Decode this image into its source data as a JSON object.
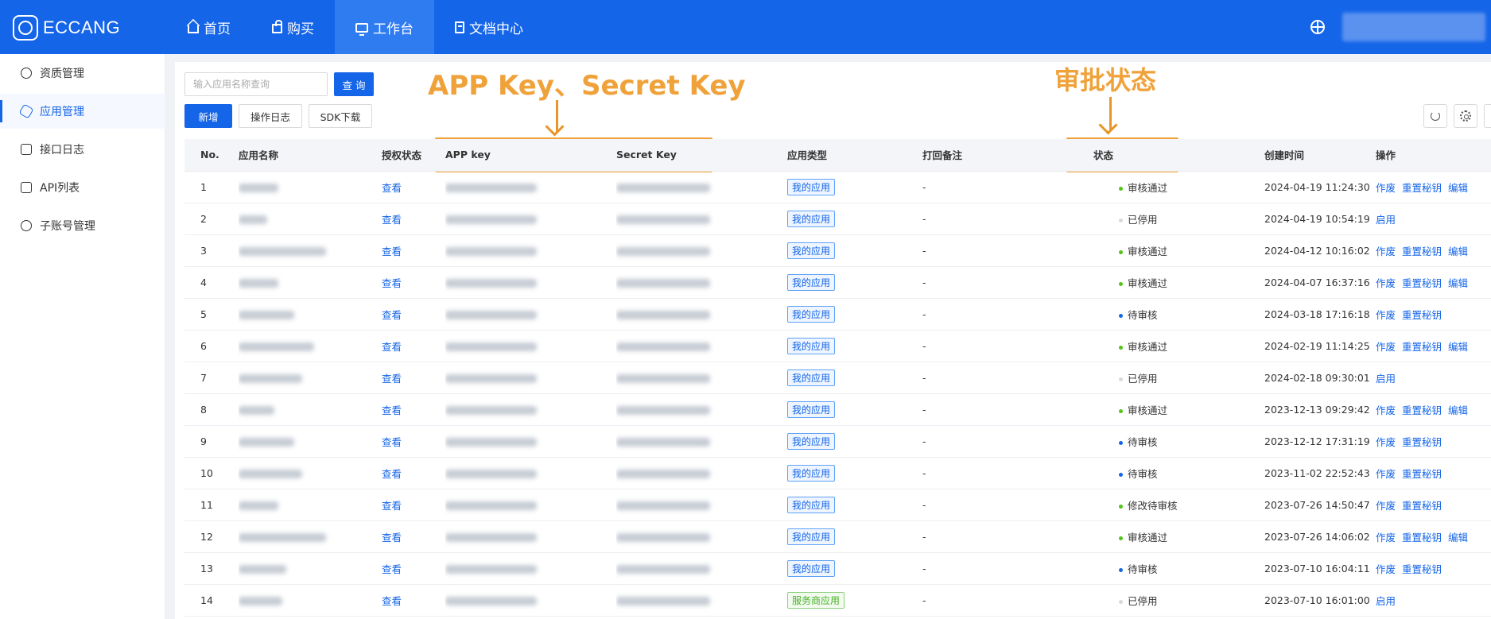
{
  "topbar": {
    "logo": "ECCANG",
    "nav": [
      {
        "label": "首页",
        "icon": "home-icon"
      },
      {
        "label": "购买",
        "icon": "shopping-bag-icon"
      },
      {
        "label": "工作台",
        "icon": "workbench-icon"
      },
      {
        "label": "文档中心",
        "icon": "document-icon"
      }
    ],
    "active_nav": "工作台"
  },
  "sidebar": {
    "items": [
      {
        "label": "资质管理",
        "icon": "certificate-icon"
      },
      {
        "label": "应用管理",
        "icon": "app-icon"
      },
      {
        "label": "接口日志",
        "icon": "log-icon"
      },
      {
        "label": "API列表",
        "icon": "api-list-icon"
      },
      {
        "label": "子账号管理",
        "icon": "sub-account-icon"
      }
    ],
    "active": "应用管理"
  },
  "toolbar": {
    "search_placeholder": "输入应用名称查询",
    "search_btn": "查 询",
    "add_btn": "新增",
    "log_btn": "操作日志",
    "sdk_btn": "SDK下载"
  },
  "annotations": {
    "keys_label": "APP Key、Secret Key",
    "status_label": "审批状态",
    "color": "#f0a23a"
  },
  "table": {
    "headers": [
      "No.",
      "应用名称",
      "授权状态",
      "APP key",
      "Secret Key",
      "",
      "应用类型",
      "打回备注",
      "状态",
      "创建时间",
      "操作"
    ],
    "rows": [
      {
        "no": "1",
        "auth": "查看",
        "type": "我的应用",
        "remark": "-",
        "status": "审核通过",
        "status_color": "#52c41a",
        "created": "2024-04-19 11:24:30",
        "ops": [
          "作废",
          "重置秘钥",
          "编辑"
        ]
      },
      {
        "no": "2",
        "auth": "查看",
        "type": "我的应用",
        "remark": "-",
        "status": "已停用",
        "status_color": "#d9d9d9",
        "created": "2024-04-19 10:54:19",
        "ops": [
          "启用"
        ]
      },
      {
        "no": "3",
        "auth": "查看",
        "type": "我的应用",
        "remark": "-",
        "status": "审核通过",
        "status_color": "#52c41a",
        "created": "2024-04-12 10:16:02",
        "ops": [
          "作废",
          "重置秘钥",
          "编辑"
        ]
      },
      {
        "no": "4",
        "auth": "查看",
        "type": "我的应用",
        "remark": "-",
        "status": "审核通过",
        "status_color": "#52c41a",
        "created": "2024-04-07 16:37:16",
        "ops": [
          "作废",
          "重置秘钥",
          "编辑"
        ]
      },
      {
        "no": "5",
        "auth": "查看",
        "type": "我的应用",
        "remark": "-",
        "status": "待审核",
        "status_color": "#1565e8",
        "created": "2024-03-18 17:16:18",
        "ops": [
          "作废",
          "重置秘钥"
        ]
      },
      {
        "no": "6",
        "auth": "查看",
        "type": "我的应用",
        "remark": "-",
        "status": "审核通过",
        "status_color": "#52c41a",
        "created": "2024-02-19 11:14:25",
        "ops": [
          "作废",
          "重置秘钥",
          "编辑"
        ]
      },
      {
        "no": "7",
        "auth": "查看",
        "type": "我的应用",
        "remark": "-",
        "status": "已停用",
        "status_color": "#d9d9d9",
        "created": "2024-02-18 09:30:01",
        "ops": [
          "启用"
        ]
      },
      {
        "no": "8",
        "auth": "查看",
        "type": "我的应用",
        "remark": "-",
        "status": "审核通过",
        "status_color": "#52c41a",
        "created": "2023-12-13 09:29:42",
        "ops": [
          "作废",
          "重置秘钥",
          "编辑"
        ]
      },
      {
        "no": "9",
        "auth": "查看",
        "type": "我的应用",
        "remark": "-",
        "status": "待审核",
        "status_color": "#1565e8",
        "created": "2023-12-12 17:31:19",
        "ops": [
          "作废",
          "重置秘钥"
        ]
      },
      {
        "no": "10",
        "auth": "查看",
        "type": "我的应用",
        "remark": "-",
        "status": "待审核",
        "status_color": "#1565e8",
        "created": "2023-11-02 22:52:43",
        "ops": [
          "作废",
          "重置秘钥"
        ]
      },
      {
        "no": "11",
        "auth": "查看",
        "type": "我的应用",
        "remark": "-",
        "status": "修改待审核",
        "status_color": "#52c41a",
        "created": "2023-07-26 14:50:47",
        "ops": [
          "作废",
          "重置秘钥"
        ]
      },
      {
        "no": "12",
        "auth": "查看",
        "type": "我的应用",
        "remark": "-",
        "status": "审核通过",
        "status_color": "#52c41a",
        "created": "2023-07-26 14:06:02",
        "ops": [
          "作废",
          "重置秘钥",
          "编辑"
        ]
      },
      {
        "no": "13",
        "auth": "查看",
        "type": "我的应用",
        "remark": "-",
        "status": "待审核",
        "status_color": "#1565e8",
        "created": "2023-07-10 16:04:11",
        "ops": [
          "作废",
          "重置秘钥"
        ]
      },
      {
        "no": "14",
        "auth": "查看",
        "type": "服务商应用",
        "remark": "-",
        "status": "已停用",
        "status_color": "#d9d9d9",
        "created": "2023-07-10 16:01:00",
        "ops": [
          "启用"
        ]
      }
    ]
  }
}
